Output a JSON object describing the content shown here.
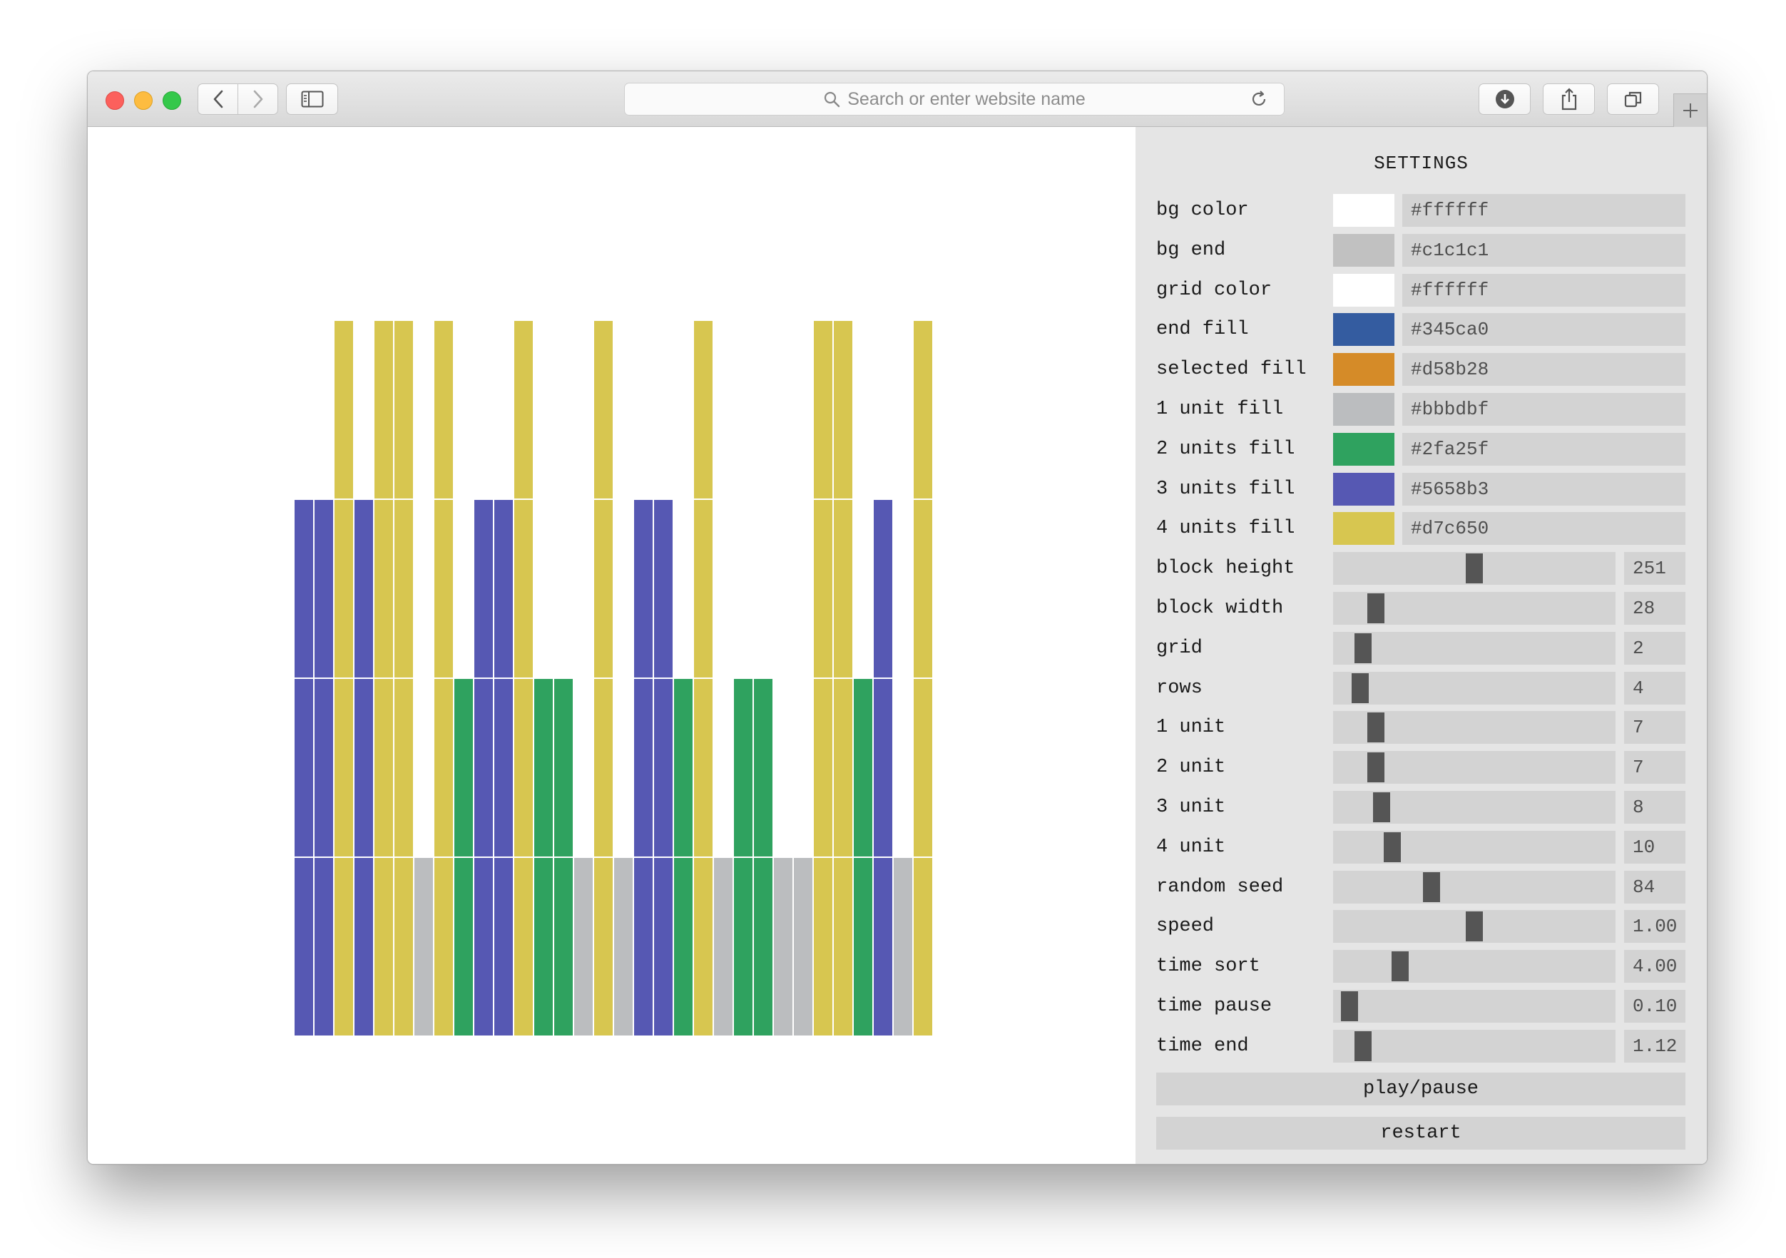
{
  "browser": {
    "address_placeholder": "Search or enter website name"
  },
  "settings": {
    "title": "SETTINGS",
    "colors": [
      {
        "label": "bg color",
        "value": "#ffffff",
        "swatch": "#ffffff"
      },
      {
        "label": "bg end",
        "value": "#c1c1c1",
        "swatch": "#c1c1c1"
      },
      {
        "label": "grid color",
        "value": "#ffffff",
        "swatch": "#ffffff"
      },
      {
        "label": "end fill",
        "value": "#345ca0",
        "swatch": "#345ca0"
      },
      {
        "label": "selected fill",
        "value": "#d58b28",
        "swatch": "#d58b28"
      },
      {
        "label": "1 unit fill",
        "value": "#bbbdbf",
        "swatch": "#bbbdbf"
      },
      {
        "label": "2 units fill",
        "value": "#2fa25f",
        "swatch": "#2fa25f"
      },
      {
        "label": "3 units fill",
        "value": "#5658b3",
        "swatch": "#5658b3"
      },
      {
        "label": "4 units fill",
        "value": "#d7c650",
        "swatch": "#d7c650"
      }
    ],
    "sliders": [
      {
        "label": "block height",
        "value": "251",
        "level": 0.5
      },
      {
        "label": "block width",
        "value": "28",
        "level": 0.13
      },
      {
        "label": "grid",
        "value": "2",
        "level": 0.08
      },
      {
        "label": "rows",
        "value": "4",
        "level": 0.07
      },
      {
        "label": "1 unit",
        "value": "7",
        "level": 0.13
      },
      {
        "label": "2 unit",
        "value": "7",
        "level": 0.13
      },
      {
        "label": "3 unit",
        "value": "8",
        "level": 0.15
      },
      {
        "label": "4 unit",
        "value": "10",
        "level": 0.19
      },
      {
        "label": "random seed",
        "value": "84",
        "level": 0.34
      },
      {
        "label": "speed",
        "value": "1.00",
        "level": 0.5
      },
      {
        "label": "time sort",
        "value": "4.00",
        "level": 0.22
      },
      {
        "label": "time pause",
        "value": "0.10",
        "level": 0.03
      },
      {
        "label": "time end",
        "value": "1.12",
        "level": 0.08
      }
    ],
    "buttons": {
      "play_pause": "play/pause",
      "restart": "restart"
    }
  },
  "visual": {
    "columns": [
      3,
      3,
      4,
      3,
      4,
      4,
      1,
      4,
      2,
      3,
      3,
      4,
      2,
      2,
      1,
      4,
      1,
      3,
      3,
      2,
      4,
      1,
      2,
      2,
      1,
      1,
      4,
      4,
      2,
      3,
      1,
      4
    ],
    "fills": {
      "1": "#bbbdbf",
      "2": "#2fa25f",
      "3": "#5658b3",
      "4": "#d7c650"
    },
    "grid_color": "#ffffff",
    "rows": 4
  }
}
